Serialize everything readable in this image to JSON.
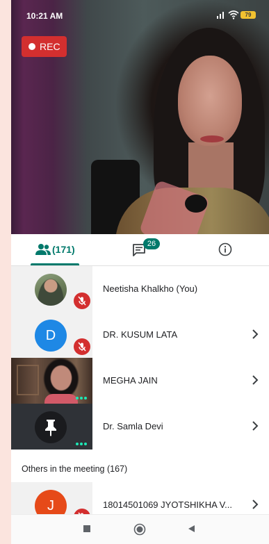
{
  "status_bar": {
    "time": "10:21 AM",
    "battery": "79"
  },
  "recording_badge": {
    "label": "REC"
  },
  "tabs": {
    "people_count": "(171)",
    "chat_unread": "26",
    "accent_color": "#00796b"
  },
  "participants": [
    {
      "name": "Neetisha Khalkho (You)",
      "avatar": "photo",
      "muted": true
    },
    {
      "name": "DR. KUSUM LATA",
      "avatar_letter": "D",
      "avatar_color": "#1e88e5",
      "muted": true
    },
    {
      "name": "MEGHA JAIN",
      "avatar": "video",
      "muted": false
    },
    {
      "name": "Dr. Samla Devi",
      "avatar": "pin-icon",
      "muted": false
    }
  ],
  "others_section": {
    "title": "Others in the meeting (167)",
    "items": [
      {
        "name": "18014501069 JYOTSHIKHA V...",
        "avatar_letter": "J",
        "avatar_color": "#e64a19",
        "muted": true
      }
    ]
  },
  "colors": {
    "mute_red": "#d32f2f",
    "active_dots": "#1de9b6"
  }
}
